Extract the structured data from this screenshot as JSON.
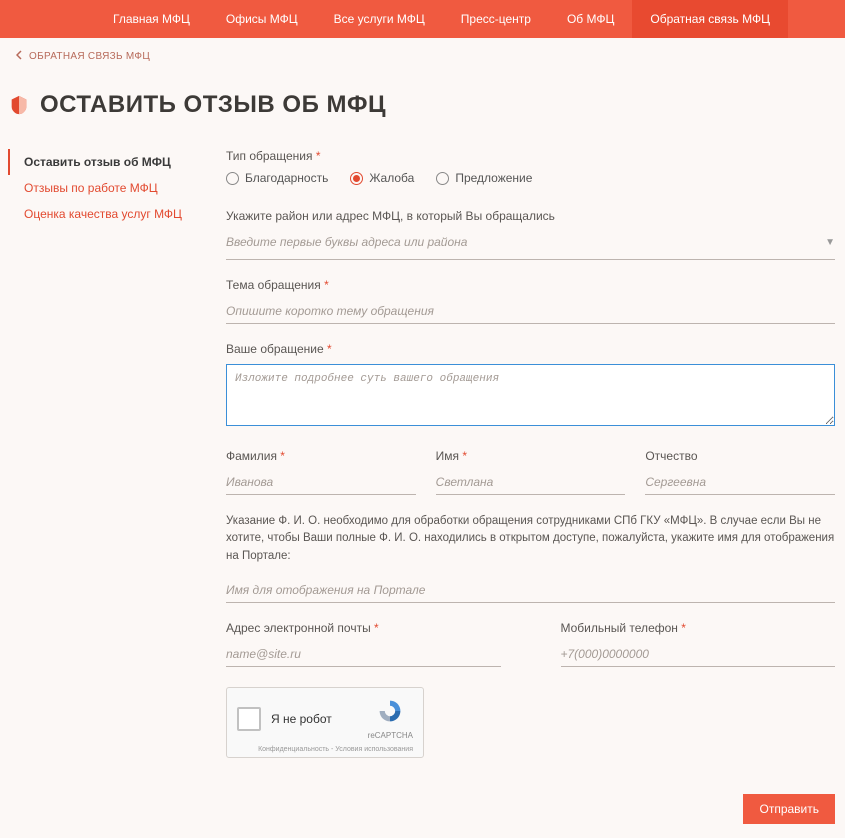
{
  "nav": {
    "items": [
      "Главная МФЦ",
      "Офисы МФЦ",
      "Все услуги МФЦ",
      "Пресс-центр",
      "Об МФЦ",
      "Обратная связь МФЦ"
    ],
    "active_index": 5
  },
  "breadcrumb": {
    "label": "ОБРАТНАЯ СВЯЗЬ МФЦ"
  },
  "page": {
    "title": "ОСТАВИТЬ ОТЗЫВ ОБ МФЦ"
  },
  "sidebar": {
    "items": [
      "Оставить отзыв об МФЦ",
      "Отзывы по работе МФЦ",
      "Оценка качества услуг МФЦ"
    ],
    "active_index": 0
  },
  "form": {
    "type": {
      "label": "Тип обращения",
      "options": [
        "Благодарность",
        "Жалоба",
        "Предложение"
      ],
      "selected_index": 1
    },
    "district": {
      "label": "Укажите район или адрес МФЦ, в который Вы обращались",
      "placeholder": "Введите первые буквы адреса или района"
    },
    "subject": {
      "label": "Тема обращения",
      "placeholder": "Опишите коротко тему обращения"
    },
    "message": {
      "label": "Ваше обращение",
      "placeholder": "Изложите подробнее суть вашего обращения"
    },
    "lastname": {
      "label": "Фамилия",
      "placeholder": "Иванова"
    },
    "firstname": {
      "label": "Имя",
      "placeholder": "Светлана"
    },
    "patronymic": {
      "label": "Отчество",
      "placeholder": "Сергеевна"
    },
    "fio_hint": "Указание Ф. И. О. необходимо для обработки обращения сотрудниками СПб ГКУ «МФЦ». В случае если Вы не хотите, чтобы Ваши полные Ф. И. О. находились в открытом доступе, пожалуйста, укажите имя для отображения на Портале:",
    "display_name": {
      "placeholder": "Имя для отображения на Портале"
    },
    "email": {
      "label": "Адрес электронной почты",
      "placeholder": "name@site.ru"
    },
    "phone": {
      "label": "Мобильный телефон",
      "placeholder": "+7(000)0000000"
    },
    "recaptcha": {
      "label": "Я не робот",
      "brand": "reCAPTCHA",
      "foot": "Конфиденциальность - Условия использования"
    },
    "submit": "Отправить"
  }
}
